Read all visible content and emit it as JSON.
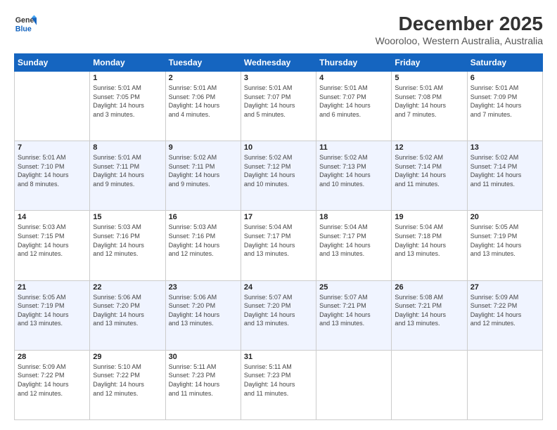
{
  "logo": {
    "line1": "General",
    "line2": "Blue"
  },
  "title": "December 2025",
  "location": "Wooroloo, Western Australia, Australia",
  "headers": [
    "Sunday",
    "Monday",
    "Tuesday",
    "Wednesday",
    "Thursday",
    "Friday",
    "Saturday"
  ],
  "weeks": [
    [
      {
        "day": "",
        "content": ""
      },
      {
        "day": "1",
        "content": "Sunrise: 5:01 AM\nSunset: 7:05 PM\nDaylight: 14 hours\nand 3 minutes."
      },
      {
        "day": "2",
        "content": "Sunrise: 5:01 AM\nSunset: 7:06 PM\nDaylight: 14 hours\nand 4 minutes."
      },
      {
        "day": "3",
        "content": "Sunrise: 5:01 AM\nSunset: 7:07 PM\nDaylight: 14 hours\nand 5 minutes."
      },
      {
        "day": "4",
        "content": "Sunrise: 5:01 AM\nSunset: 7:07 PM\nDaylight: 14 hours\nand 6 minutes."
      },
      {
        "day": "5",
        "content": "Sunrise: 5:01 AM\nSunset: 7:08 PM\nDaylight: 14 hours\nand 7 minutes."
      },
      {
        "day": "6",
        "content": "Sunrise: 5:01 AM\nSunset: 7:09 PM\nDaylight: 14 hours\nand 7 minutes."
      }
    ],
    [
      {
        "day": "7",
        "content": "Sunrise: 5:01 AM\nSunset: 7:10 PM\nDaylight: 14 hours\nand 8 minutes."
      },
      {
        "day": "8",
        "content": "Sunrise: 5:01 AM\nSunset: 7:11 PM\nDaylight: 14 hours\nand 9 minutes."
      },
      {
        "day": "9",
        "content": "Sunrise: 5:02 AM\nSunset: 7:11 PM\nDaylight: 14 hours\nand 9 minutes."
      },
      {
        "day": "10",
        "content": "Sunrise: 5:02 AM\nSunset: 7:12 PM\nDaylight: 14 hours\nand 10 minutes."
      },
      {
        "day": "11",
        "content": "Sunrise: 5:02 AM\nSunset: 7:13 PM\nDaylight: 14 hours\nand 10 minutes."
      },
      {
        "day": "12",
        "content": "Sunrise: 5:02 AM\nSunset: 7:14 PM\nDaylight: 14 hours\nand 11 minutes."
      },
      {
        "day": "13",
        "content": "Sunrise: 5:02 AM\nSunset: 7:14 PM\nDaylight: 14 hours\nand 11 minutes."
      }
    ],
    [
      {
        "day": "14",
        "content": "Sunrise: 5:03 AM\nSunset: 7:15 PM\nDaylight: 14 hours\nand 12 minutes."
      },
      {
        "day": "15",
        "content": "Sunrise: 5:03 AM\nSunset: 7:16 PM\nDaylight: 14 hours\nand 12 minutes."
      },
      {
        "day": "16",
        "content": "Sunrise: 5:03 AM\nSunset: 7:16 PM\nDaylight: 14 hours\nand 12 minutes."
      },
      {
        "day": "17",
        "content": "Sunrise: 5:04 AM\nSunset: 7:17 PM\nDaylight: 14 hours\nand 13 minutes."
      },
      {
        "day": "18",
        "content": "Sunrise: 5:04 AM\nSunset: 7:17 PM\nDaylight: 14 hours\nand 13 minutes."
      },
      {
        "day": "19",
        "content": "Sunrise: 5:04 AM\nSunset: 7:18 PM\nDaylight: 14 hours\nand 13 minutes."
      },
      {
        "day": "20",
        "content": "Sunrise: 5:05 AM\nSunset: 7:19 PM\nDaylight: 14 hours\nand 13 minutes."
      }
    ],
    [
      {
        "day": "21",
        "content": "Sunrise: 5:05 AM\nSunset: 7:19 PM\nDaylight: 14 hours\nand 13 minutes."
      },
      {
        "day": "22",
        "content": "Sunrise: 5:06 AM\nSunset: 7:20 PM\nDaylight: 14 hours\nand 13 minutes."
      },
      {
        "day": "23",
        "content": "Sunrise: 5:06 AM\nSunset: 7:20 PM\nDaylight: 14 hours\nand 13 minutes."
      },
      {
        "day": "24",
        "content": "Sunrise: 5:07 AM\nSunset: 7:20 PM\nDaylight: 14 hours\nand 13 minutes."
      },
      {
        "day": "25",
        "content": "Sunrise: 5:07 AM\nSunset: 7:21 PM\nDaylight: 14 hours\nand 13 minutes."
      },
      {
        "day": "26",
        "content": "Sunrise: 5:08 AM\nSunset: 7:21 PM\nDaylight: 14 hours\nand 13 minutes."
      },
      {
        "day": "27",
        "content": "Sunrise: 5:09 AM\nSunset: 7:22 PM\nDaylight: 14 hours\nand 12 minutes."
      }
    ],
    [
      {
        "day": "28",
        "content": "Sunrise: 5:09 AM\nSunset: 7:22 PM\nDaylight: 14 hours\nand 12 minutes."
      },
      {
        "day": "29",
        "content": "Sunrise: 5:10 AM\nSunset: 7:22 PM\nDaylight: 14 hours\nand 12 minutes."
      },
      {
        "day": "30",
        "content": "Sunrise: 5:11 AM\nSunset: 7:23 PM\nDaylight: 14 hours\nand 11 minutes."
      },
      {
        "day": "31",
        "content": "Sunrise: 5:11 AM\nSunset: 7:23 PM\nDaylight: 14 hours\nand 11 minutes."
      },
      {
        "day": "",
        "content": ""
      },
      {
        "day": "",
        "content": ""
      },
      {
        "day": "",
        "content": ""
      }
    ]
  ]
}
